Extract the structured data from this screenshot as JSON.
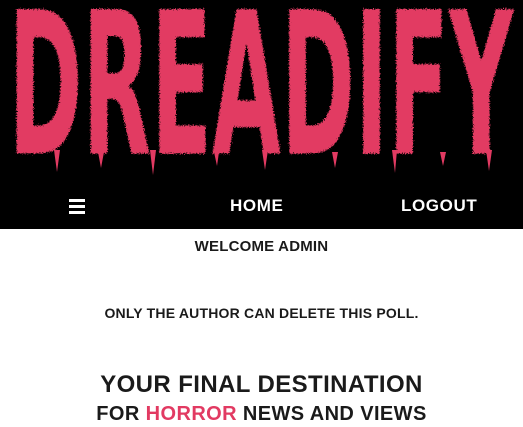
{
  "brand": {
    "logo_text": "DREADIFY",
    "accent_color": "#e23a62",
    "header_bg": "#000000"
  },
  "nav": {
    "menu_icon": "hamburger-icon",
    "home_label": "HOME",
    "logout_label": "LOGOUT"
  },
  "main": {
    "welcome": "WELCOME ADMIN",
    "notice": "ONLY THE AUTHOR CAN DELETE THIS POLL.",
    "tagline_line1": "YOUR FINAL DESTINATION",
    "tagline_line2_prefix": "FOR ",
    "tagline_line2_accent": "HORROR",
    "tagline_line2_suffix": " NEWS AND VIEWS"
  }
}
